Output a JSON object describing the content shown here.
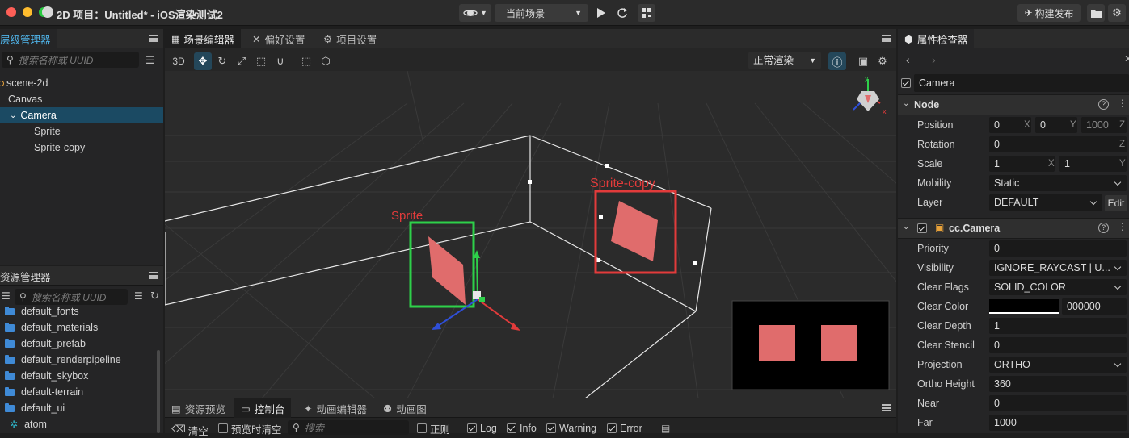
{
  "titlebar": {
    "title": "2D 项目：Untitled* - iOS渲染测试2",
    "scene_select": "当前场景",
    "build_label": "构建发布"
  },
  "hierarchy": {
    "tab_label": "层级管理器",
    "search_placeholder": "搜索名称或 UUID",
    "items": [
      {
        "label": "scene-2d"
      },
      {
        "label": "Canvas"
      },
      {
        "label": "Camera"
      },
      {
        "label": "Sprite"
      },
      {
        "label": "Sprite-copy"
      }
    ]
  },
  "assets": {
    "tab_label": "资源管理器",
    "search_placeholder": "搜索名称或 UUID",
    "items": [
      {
        "label": "default_fonts"
      },
      {
        "label": "default_materials"
      },
      {
        "label": "default_prefab"
      },
      {
        "label": "default_renderpipeline"
      },
      {
        "label": "default_skybox"
      },
      {
        "label": "default-terrain"
      },
      {
        "label": "default_ui"
      },
      {
        "label": "atom"
      }
    ]
  },
  "scene_editor": {
    "tabs": [
      {
        "label": "场景编辑器"
      },
      {
        "label": "偏好设置"
      },
      {
        "label": "项目设置"
      }
    ],
    "mode_3d": "3D",
    "render_mode": "正常渲染",
    "sprite_label": "Sprite",
    "sprite_copy_label": "Sprite-copy",
    "gizmo_x": "x",
    "gizmo_y": "y"
  },
  "console": {
    "tabs": [
      {
        "label": "资源预览"
      },
      {
        "label": "控制台"
      },
      {
        "label": "动画编辑器"
      },
      {
        "label": "动画图"
      }
    ],
    "clear_label": "清空",
    "clear_on_preview": "预览时清空",
    "search_placeholder": "搜索",
    "regex": "正则",
    "log": "Log",
    "info": "Info",
    "warning": "Warning",
    "error": "Error"
  },
  "inspector": {
    "tab_label": "属性检查器",
    "node_name": "Camera",
    "node_section": "Node",
    "position_label": "Position",
    "position": {
      "x": "0",
      "y": "0",
      "z": "1000"
    },
    "rotation_label": "Rotation",
    "rotation_z": "0",
    "scale_label": "Scale",
    "scale": {
      "x": "1",
      "y": "1"
    },
    "mobility_label": "Mobility",
    "mobility": "Static",
    "layer_label": "Layer",
    "layer": "DEFAULT",
    "edit_label": "Edit",
    "camera_section": "cc.Camera",
    "axis_x": "X",
    "axis_y": "Y",
    "axis_z": "Z",
    "camera_props": [
      {
        "label": "Priority",
        "value": "0"
      },
      {
        "label": "Visibility",
        "value": "IGNORE_RAYCAST | U..."
      },
      {
        "label": "Clear Flags",
        "value": "SOLID_COLOR"
      },
      {
        "label": "Clear Color",
        "value": "000000"
      },
      {
        "label": "Clear Depth",
        "value": "1"
      },
      {
        "label": "Clear Stencil",
        "value": "0"
      },
      {
        "label": "Projection",
        "value": "ORTHO"
      },
      {
        "label": "Ortho Height",
        "value": "360"
      },
      {
        "label": "Near",
        "value": "0"
      },
      {
        "label": "Far",
        "value": "1000"
      }
    ]
  },
  "colors": {
    "accent": "#1f8fb3",
    "selected_row": "#1b4a63",
    "sprite_fill": "#e06c6c",
    "select_green": "#2ed04a",
    "select_red": "#e23b3b"
  }
}
